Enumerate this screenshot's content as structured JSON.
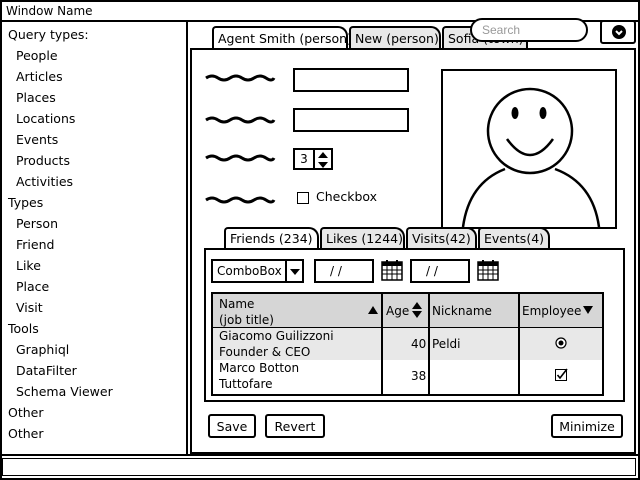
{
  "window": {
    "title": "Window Name"
  },
  "sidebar": {
    "items": [
      {
        "label": "Query types:",
        "indent": false
      },
      {
        "label": "People",
        "indent": true
      },
      {
        "label": "Articles",
        "indent": true
      },
      {
        "label": "Places",
        "indent": true
      },
      {
        "label": "Locations",
        "indent": true
      },
      {
        "label": "Events",
        "indent": true
      },
      {
        "label": "Products",
        "indent": true
      },
      {
        "label": "Activities",
        "indent": true
      },
      {
        "label": "Types",
        "indent": false
      },
      {
        "label": "Person",
        "indent": true
      },
      {
        "label": "Friend",
        "indent": true
      },
      {
        "label": "Like",
        "indent": true
      },
      {
        "label": "Place",
        "indent": true
      },
      {
        "label": "Visit",
        "indent": true
      },
      {
        "label": "Tools",
        "indent": false
      },
      {
        "label": "Graphiql",
        "indent": true
      },
      {
        "label": "DataFilter",
        "indent": true
      },
      {
        "label": "Schema Viewer",
        "indent": true
      },
      {
        "label": "Other",
        "indent": false
      },
      {
        "label": "Other",
        "indent": false
      }
    ]
  },
  "tabs": [
    {
      "label": "Agent Smith (person)",
      "active": true
    },
    {
      "label": "New (person)",
      "active": false
    },
    {
      "label": "Sofia (town)",
      "active": false
    }
  ],
  "search": {
    "placeholder": "Search",
    "visible_text": "h"
  },
  "form": {
    "stepper_value": "3",
    "checkbox_label": "Checkbox",
    "checkbox_checked": false
  },
  "subtabs": [
    {
      "label": "Friends (234)",
      "active": true
    },
    {
      "label": "Likes (1244)",
      "active": false
    },
    {
      "label": "Visits(42)",
      "active": false
    },
    {
      "label": "Events(4)",
      "active": false
    }
  ],
  "filters": {
    "combobox_value": "ComboBox",
    "date_from": "/ /",
    "date_to": "/ /"
  },
  "grid": {
    "columns": [
      {
        "label": "Name",
        "sublabel": "(job title)",
        "sort": "asc"
      },
      {
        "label": "Age",
        "sort": "both"
      },
      {
        "label": "Nickname",
        "sort": "none"
      },
      {
        "label": "Employee",
        "sort": "desc"
      }
    ],
    "rows": [
      {
        "name": "Giacomo Guilizzoni",
        "title": "Founder & CEO",
        "age": "40",
        "nickname": "Peldi",
        "employee": "radio-selected"
      },
      {
        "name": "Marco Botton",
        "title": "Tuttofare",
        "age": "38",
        "nickname": "",
        "employee": "checkbox-checked"
      }
    ]
  },
  "buttons": {
    "save": "Save",
    "revert": "Revert",
    "minimize": "Minimize"
  }
}
